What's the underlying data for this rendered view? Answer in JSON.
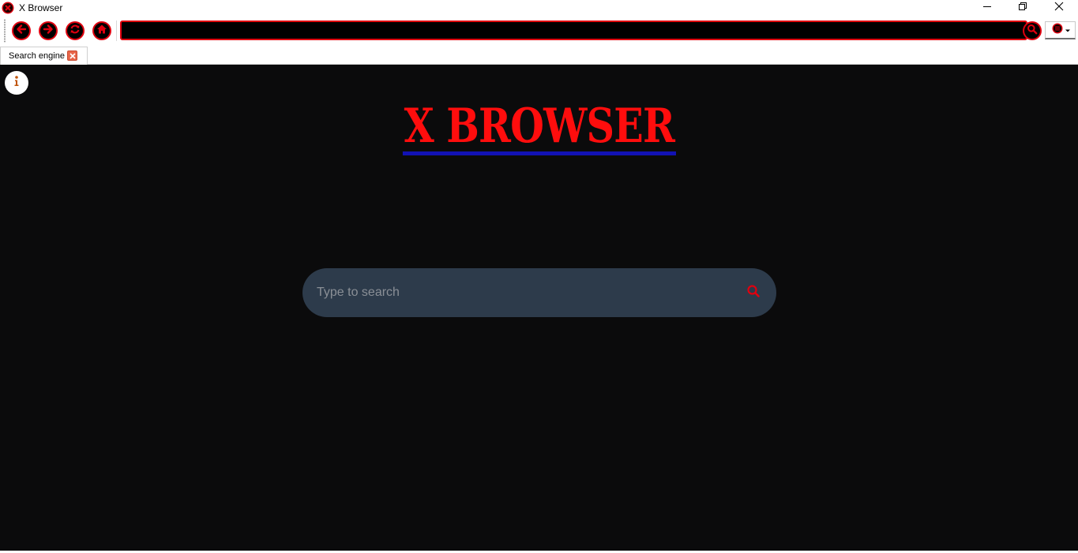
{
  "window": {
    "title": "X Browser",
    "controls": {
      "minimize": "minimize-icon",
      "restore": "restore-icon",
      "close": "close-icon"
    }
  },
  "toolbar": {
    "buttons": [
      "back-icon",
      "forward-icon",
      "reload-icon",
      "home-icon"
    ],
    "address_value": "",
    "search_button": "search-icon",
    "menu_button": "menu-icon"
  },
  "tabs": [
    {
      "label": "Search engine",
      "active": true
    }
  ],
  "page": {
    "logo_text": "X BROWSER",
    "search": {
      "placeholder": "Type to search",
      "value": ""
    },
    "info_icon": "info-icon"
  },
  "colors": {
    "accent_red": "#e0000f",
    "logo_red": "#ff0d0d",
    "logo_underline": "#1212b4",
    "page_bg": "#0b0b0c",
    "search_bg": "#2d3b4b"
  }
}
